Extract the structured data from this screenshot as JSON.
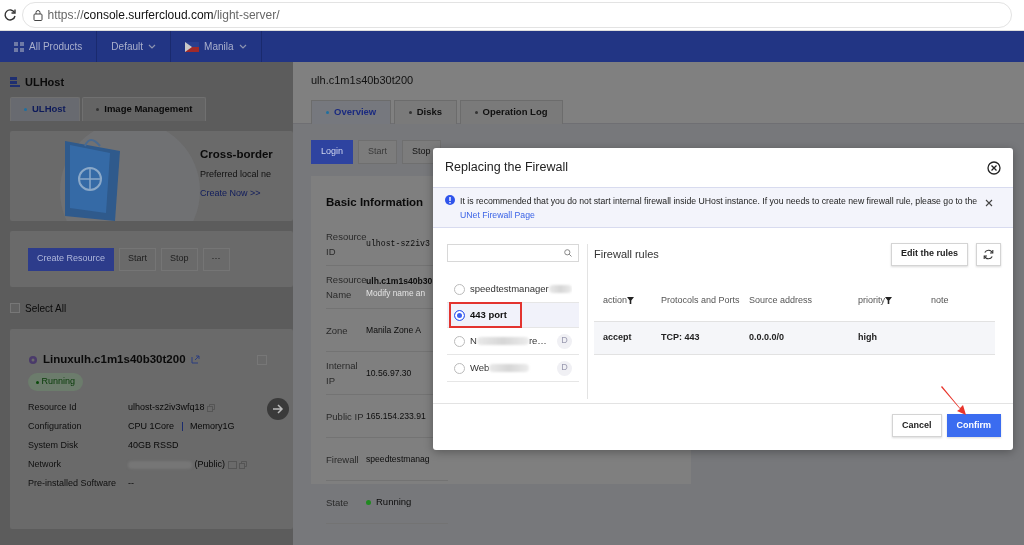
{
  "browser": {
    "url_scheme": "https://",
    "url_host": "console.surfercloud.com",
    "url_path": "/light-server/"
  },
  "top_nav": [
    {
      "label": "All Products",
      "kind": "products"
    },
    {
      "label": "Default",
      "kind": "dropdown"
    },
    {
      "label": "Manila",
      "kind": "region"
    }
  ],
  "left_panel": {
    "title": "ULHost",
    "tabs": [
      {
        "label": "ULHost",
        "selected": true
      },
      {
        "label": "Image Management",
        "selected": false
      }
    ],
    "banner": {
      "title": "Cross-border",
      "text": "Preferred local ne",
      "link": "Create Now >>"
    },
    "actions": [
      {
        "label": "Create Resource",
        "kind": "primary"
      },
      {
        "label": "Start",
        "kind": "disabled"
      },
      {
        "label": "Stop",
        "kind": "disabled"
      },
      {
        "label": "···",
        "kind": "more"
      }
    ],
    "select_all": {
      "label": "Select All",
      "checked": false
    },
    "instance": {
      "name": "Linuxulh.c1m1s40b30t200",
      "checked": false,
      "status": "Running",
      "fields": [
        {
          "label": "Resource Id",
          "values": [
            "ulhost-sz2iv3wfq18"
          ],
          "copyable": true
        },
        {
          "label": "Configuration",
          "values": [
            "CPU 1Core",
            "Memory1G"
          ]
        },
        {
          "label": "System Disk",
          "values": [
            "40GB RSSD"
          ]
        },
        {
          "label": "Network",
          "values": [
            "(Public)"
          ],
          "redacted": true,
          "copyable": true
        },
        {
          "label": "Pre-installed Software",
          "values": [
            "--"
          ]
        }
      ]
    }
  },
  "drawer": {
    "title": "ulh.c1m1s40b30t200",
    "tabs": [
      {
        "label": "Overview",
        "selected": true
      },
      {
        "label": "Disks",
        "selected": false
      },
      {
        "label": "Operation Log",
        "selected": false
      }
    ],
    "actions": [
      {
        "label": "Login",
        "kind": "primary"
      },
      {
        "label": "Start",
        "kind": "disabled"
      },
      {
        "label": "Stop",
        "kind": "default"
      }
    ],
    "basic_info": {
      "title": "Basic Information",
      "rows": [
        {
          "label": "Resource ID",
          "value": "ulhost-sz2iv3",
          "kind": "mono"
        },
        {
          "label": "Resource Name",
          "value": "ulh.c1m1s40b30",
          "hint": "Modify name an",
          "kind": "name"
        },
        {
          "label": "Zone",
          "value": "Manila Zone A",
          "kind": "text"
        },
        {
          "label": "Internal IP",
          "value": "10.56.97.30",
          "kind": "text"
        },
        {
          "label": "Public IP",
          "value": "165.154.233.91",
          "kind": "text"
        },
        {
          "label": "Firewall",
          "value": "speedtestmanag",
          "kind": "text"
        },
        {
          "label": "State",
          "value": "Running",
          "kind": "status"
        }
      ]
    }
  },
  "modal": {
    "title": "Replacing the Firewall",
    "alert": {
      "text": "It is recommended that you do not start internal firewall inside UHost instance. If you needs to create new firewall rule, please go to the",
      "link": "UNet Firewall Page"
    },
    "firewalls": [
      {
        "name": "speedtestmanager",
        "selected": false,
        "redacted": true,
        "highlighted": false
      },
      {
        "name": "443 port",
        "selected": true,
        "redacted": false,
        "highlighted": true
      },
      {
        "name": "N",
        "tail": "re…",
        "badge": "D",
        "selected": false,
        "redacted": true,
        "highlighted": false
      },
      {
        "name": "Web",
        "badge": "D",
        "selected": false,
        "redacted": true,
        "highlighted": false
      }
    ],
    "rules_title": "Firewall rules",
    "edit_button": "Edit the rules",
    "columns": [
      {
        "label": "action",
        "filter": true
      },
      {
        "label": "Protocols and Ports",
        "filter": false
      },
      {
        "label": "Source address",
        "filter": false
      },
      {
        "label": "priority",
        "filter": true
      },
      {
        "label": "note",
        "filter": false
      }
    ],
    "rows": [
      [
        "accept",
        "TCP: 443",
        "0.0.0.0/0",
        "high"
      ]
    ],
    "buttons": [
      {
        "label": "Cancel",
        "kind": "default"
      },
      {
        "label": "Confirm",
        "kind": "primary"
      }
    ],
    "pointer_arrow": true
  }
}
